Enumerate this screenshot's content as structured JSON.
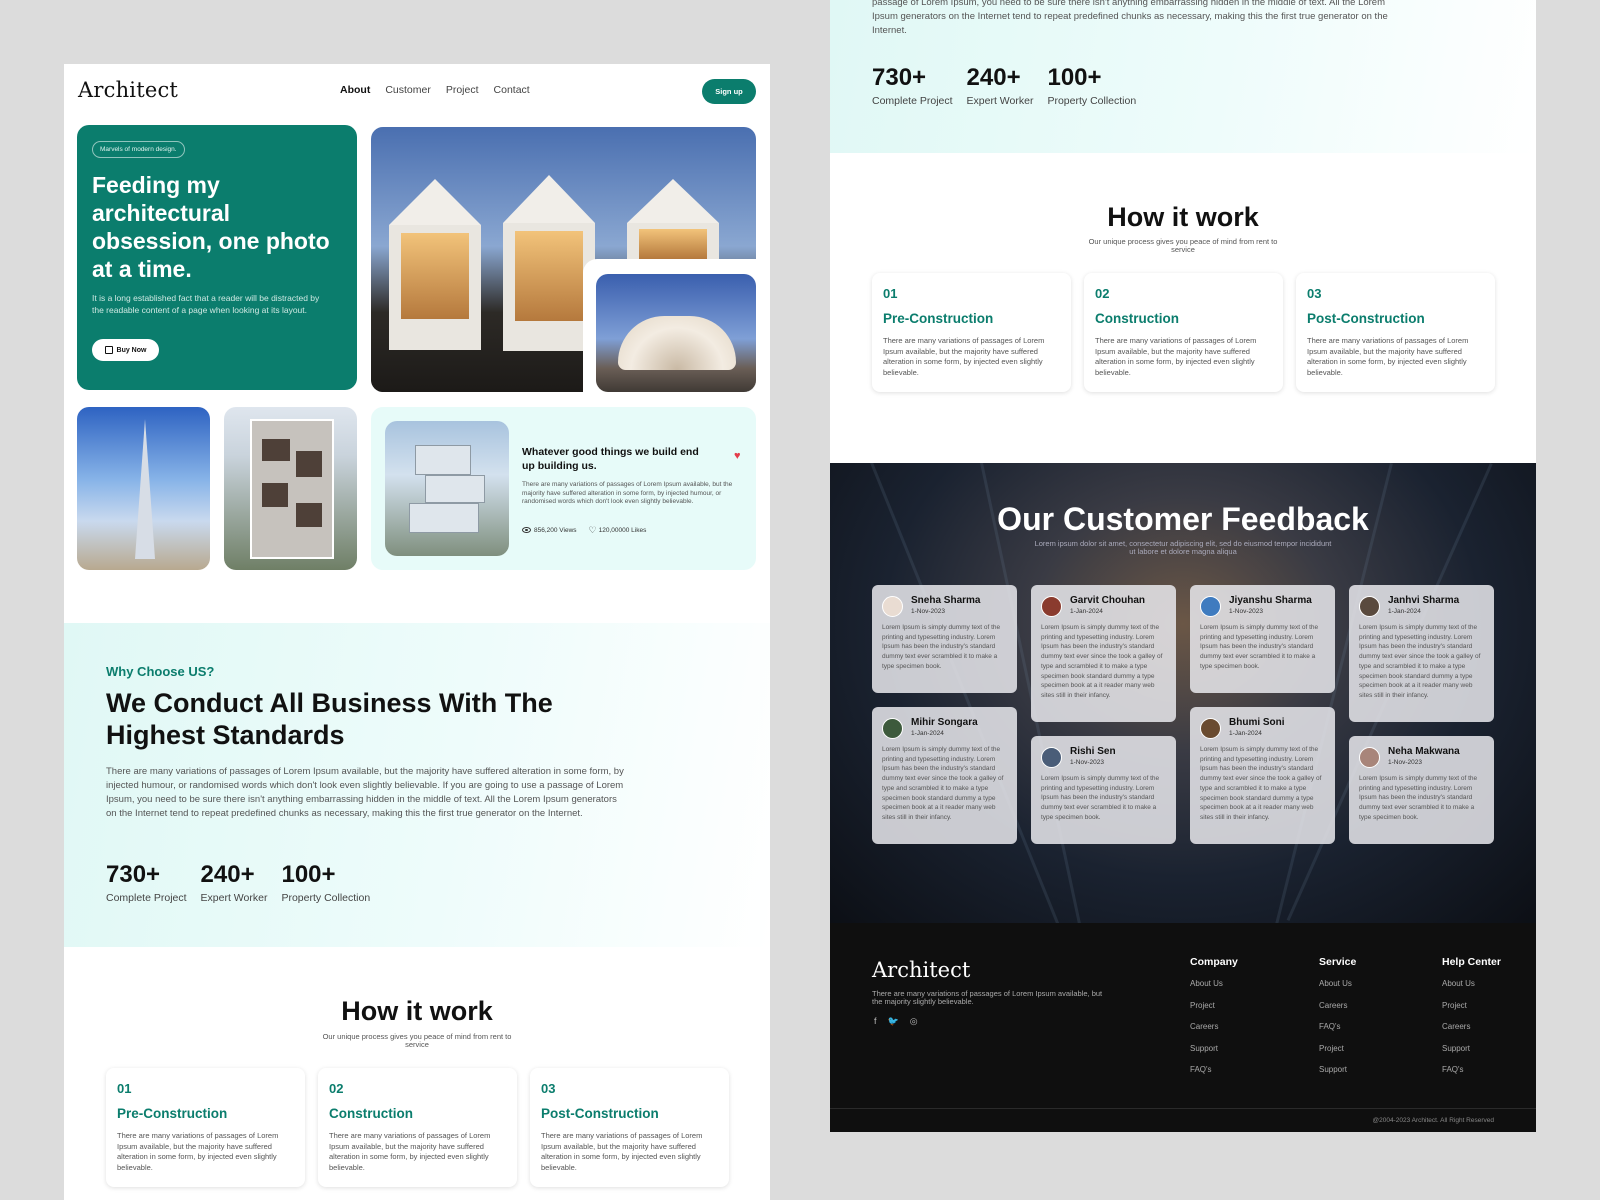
{
  "nav": {
    "logo": "Architect",
    "links": [
      "About",
      "Customer",
      "Project",
      "Contact"
    ],
    "signup": "Sign up"
  },
  "hero": {
    "pill": "Marvels of modern design.",
    "title": "Feeding my architectural obsession, one photo at a time.",
    "text": "It is a long established fact that a reader will be distracted by the readable content of a page when looking at its layout.",
    "button": "Buy Now"
  },
  "feature": {
    "title": "Whatever good things we build end up building us.",
    "text": "There are many variations of passages of Lorem Ipsum available, but the majority have suffered alteration in some form, by injected humour, or randomised words which don't look even slightly believable.",
    "views": "856,200 Views",
    "likes": "120,00000 Likes"
  },
  "why": {
    "subtitle": "Why Choose US?",
    "title": "We Conduct All Business With The Highest Standards",
    "text": "There are many variations of passages of Lorem Ipsum available, but the majority have suffered alteration in some form, by injected humour, or randomised words which don't look even slightly believable. If you are going to use a passage of Lorem Ipsum, you need to be sure there isn't anything embarrassing hidden in the middle of text. All the Lorem Ipsum generators on the Internet tend to repeat predefined chunks as necessary, making this the first true generator on the Internet.",
    "text_cut": "passage of Lorem Ipsum, you need to be sure there isn't anything embarrassing hidden in the middle of text. All the Lorem Ipsum generators on the Internet tend to repeat predefined chunks as necessary, making this the first true generator on the Internet.",
    "stats": [
      {
        "num": "730+",
        "label": "Complete Project"
      },
      {
        "num": "240+",
        "label": "Expert Worker"
      },
      {
        "num": "100+",
        "label": "Property Collection"
      }
    ]
  },
  "how": {
    "title": "How it work",
    "subtitle": "Our unique process gives you peace of mind from rent to service",
    "steps": [
      {
        "num": "01",
        "title": "Pre-Construction",
        "text": "There are many variations of passages of Lorem Ipsum available, but the majority have suffered alteration in some form, by injected even slightly believable."
      },
      {
        "num": "02",
        "title": "Construction",
        "text": "There are many variations of passages of Lorem Ipsum available, but the majority have suffered alteration in some form, by injected even slightly believable."
      },
      {
        "num": "03",
        "title": "Post-Construction",
        "text": "There are many variations of passages of Lorem Ipsum available, but the majority have suffered alteration in some form, by injected even slightly believable."
      }
    ]
  },
  "feedback": {
    "title": "Our Customer Feedback",
    "subtitle": "Lorem ipsum dolor sit amet, consectetur adipiscing elit, sed do eiusmod tempor incididunt ut labore et dolore magna aliqua",
    "cards": [
      {
        "name": "Sneha Sharma",
        "date": "1-Nov-2023",
        "text": "Lorem Ipsum is simply dummy text of the printing and typesetting industry. Lorem Ipsum has been the industry's standard dummy text ever scrambled it to make a type specimen book."
      },
      {
        "name": "Garvit Chouhan",
        "date": "1-Jan-2024",
        "text": "Lorem Ipsum is simply dummy text of the printing and typesetting industry. Lorem Ipsum has been the industry's standard dummy text ever since the took a galley of type and scrambled it to make a type specimen book standard dummy a type specimen book at a it reader many web sites still in their infancy."
      },
      {
        "name": "Jiyanshu Sharma",
        "date": "1-Nov-2023",
        "text": "Lorem Ipsum is simply dummy text of the printing and typesetting industry. Lorem Ipsum has been the industry's standard dummy text ever scrambled it to make a type specimen book."
      },
      {
        "name": "Janhvi Sharma",
        "date": "1-Jan-2024",
        "text": "Lorem Ipsum is simply dummy text of the printing and typesetting industry. Lorem Ipsum has been the industry's standard dummy text ever since the took a galley of type and scrambled it to make a type specimen book standard dummy a type specimen book at a it reader many web sites still in their infancy."
      },
      {
        "name": "Mihir Songara",
        "date": "1-Jan-2024",
        "text": "Lorem Ipsum is simply dummy text of the printing and typesetting industry. Lorem Ipsum has been the industry's standard dummy text ever since the took a galley of type and scrambled it to make a type specimen book standard dummy a type specimen book at a it reader many web sites still in their infancy."
      },
      {
        "name": "Rishi Sen",
        "date": "1-Nov-2023",
        "text": "Lorem Ipsum is simply dummy text of the printing and typesetting industry. Lorem Ipsum has been the industry's standard dummy text ever scrambled it to make a type specimen book."
      },
      {
        "name": "Bhumi Soni",
        "date": "1-Jan-2024",
        "text": "Lorem Ipsum is simply dummy text of the printing and typesetting industry. Lorem Ipsum has been the industry's standard dummy text ever since the took a galley of type and scrambled it to make a type specimen book standard dummy a type specimen book at a it reader many web sites still in their infancy."
      },
      {
        "name": "Neha Makwana",
        "date": "1-Nov-2023",
        "text": "Lorem Ipsum is simply dummy text of the printing and typesetting industry. Lorem Ipsum has been the industry's standard dummy text ever scrambled it to make a type specimen book."
      }
    ]
  },
  "footer": {
    "logo": "Architect",
    "text": "There are many variations of passages of Lorem Ipsum available, but the majority slightly believable.",
    "social": [
      "facebook-icon",
      "twitter-icon",
      "instagram-icon"
    ],
    "columns": [
      {
        "title": "Company",
        "items": [
          "About Us",
          "Project",
          "Careers",
          "Support",
          "FAQ's"
        ]
      },
      {
        "title": "Service",
        "items": [
          "About Us",
          "Careers",
          "FAQ's",
          "Project",
          "Support"
        ]
      },
      {
        "title": "Help Center",
        "items": [
          "About Us",
          "Project",
          "Careers",
          "Support",
          "FAQ's"
        ]
      }
    ],
    "copyright": "@2004-2023 Architect. All Right Reserved"
  },
  "colors": {
    "brand": "#0b7d6d",
    "accent_light": "#e7fbf9",
    "heart": "#e33d4b",
    "dark": "#0f0f0f"
  }
}
